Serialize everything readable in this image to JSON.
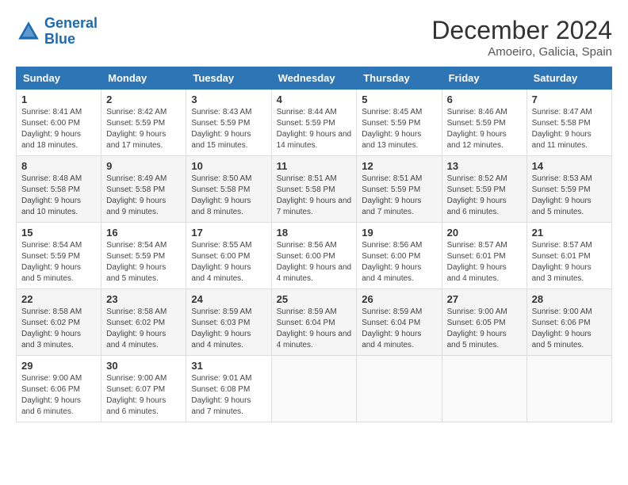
{
  "header": {
    "logo_line1": "General",
    "logo_line2": "Blue",
    "month": "December 2024",
    "location": "Amoeiro, Galicia, Spain"
  },
  "days_of_week": [
    "Sunday",
    "Monday",
    "Tuesday",
    "Wednesday",
    "Thursday",
    "Friday",
    "Saturday"
  ],
  "weeks": [
    [
      {
        "day": "1",
        "info": "Sunrise: 8:41 AM\nSunset: 6:00 PM\nDaylight: 9 hours and 18 minutes."
      },
      {
        "day": "2",
        "info": "Sunrise: 8:42 AM\nSunset: 5:59 PM\nDaylight: 9 hours and 17 minutes."
      },
      {
        "day": "3",
        "info": "Sunrise: 8:43 AM\nSunset: 5:59 PM\nDaylight: 9 hours and 15 minutes."
      },
      {
        "day": "4",
        "info": "Sunrise: 8:44 AM\nSunset: 5:59 PM\nDaylight: 9 hours and 14 minutes."
      },
      {
        "day": "5",
        "info": "Sunrise: 8:45 AM\nSunset: 5:59 PM\nDaylight: 9 hours and 13 minutes."
      },
      {
        "day": "6",
        "info": "Sunrise: 8:46 AM\nSunset: 5:59 PM\nDaylight: 9 hours and 12 minutes."
      },
      {
        "day": "7",
        "info": "Sunrise: 8:47 AM\nSunset: 5:58 PM\nDaylight: 9 hours and 11 minutes."
      }
    ],
    [
      {
        "day": "8",
        "info": "Sunrise: 8:48 AM\nSunset: 5:58 PM\nDaylight: 9 hours and 10 minutes."
      },
      {
        "day": "9",
        "info": "Sunrise: 8:49 AM\nSunset: 5:58 PM\nDaylight: 9 hours and 9 minutes."
      },
      {
        "day": "10",
        "info": "Sunrise: 8:50 AM\nSunset: 5:58 PM\nDaylight: 9 hours and 8 minutes."
      },
      {
        "day": "11",
        "info": "Sunrise: 8:51 AM\nSunset: 5:58 PM\nDaylight: 9 hours and 7 minutes."
      },
      {
        "day": "12",
        "info": "Sunrise: 8:51 AM\nSunset: 5:59 PM\nDaylight: 9 hours and 7 minutes."
      },
      {
        "day": "13",
        "info": "Sunrise: 8:52 AM\nSunset: 5:59 PM\nDaylight: 9 hours and 6 minutes."
      },
      {
        "day": "14",
        "info": "Sunrise: 8:53 AM\nSunset: 5:59 PM\nDaylight: 9 hours and 5 minutes."
      }
    ],
    [
      {
        "day": "15",
        "info": "Sunrise: 8:54 AM\nSunset: 5:59 PM\nDaylight: 9 hours and 5 minutes."
      },
      {
        "day": "16",
        "info": "Sunrise: 8:54 AM\nSunset: 5:59 PM\nDaylight: 9 hours and 5 minutes."
      },
      {
        "day": "17",
        "info": "Sunrise: 8:55 AM\nSunset: 6:00 PM\nDaylight: 9 hours and 4 minutes."
      },
      {
        "day": "18",
        "info": "Sunrise: 8:56 AM\nSunset: 6:00 PM\nDaylight: 9 hours and 4 minutes."
      },
      {
        "day": "19",
        "info": "Sunrise: 8:56 AM\nSunset: 6:00 PM\nDaylight: 9 hours and 4 minutes."
      },
      {
        "day": "20",
        "info": "Sunrise: 8:57 AM\nSunset: 6:01 PM\nDaylight: 9 hours and 4 minutes."
      },
      {
        "day": "21",
        "info": "Sunrise: 8:57 AM\nSunset: 6:01 PM\nDaylight: 9 hours and 3 minutes."
      }
    ],
    [
      {
        "day": "22",
        "info": "Sunrise: 8:58 AM\nSunset: 6:02 PM\nDaylight: 9 hours and 3 minutes."
      },
      {
        "day": "23",
        "info": "Sunrise: 8:58 AM\nSunset: 6:02 PM\nDaylight: 9 hours and 4 minutes."
      },
      {
        "day": "24",
        "info": "Sunrise: 8:59 AM\nSunset: 6:03 PM\nDaylight: 9 hours and 4 minutes."
      },
      {
        "day": "25",
        "info": "Sunrise: 8:59 AM\nSunset: 6:04 PM\nDaylight: 9 hours and 4 minutes."
      },
      {
        "day": "26",
        "info": "Sunrise: 8:59 AM\nSunset: 6:04 PM\nDaylight: 9 hours and 4 minutes."
      },
      {
        "day": "27",
        "info": "Sunrise: 9:00 AM\nSunset: 6:05 PM\nDaylight: 9 hours and 5 minutes."
      },
      {
        "day": "28",
        "info": "Sunrise: 9:00 AM\nSunset: 6:06 PM\nDaylight: 9 hours and 5 minutes."
      }
    ],
    [
      {
        "day": "29",
        "info": "Sunrise: 9:00 AM\nSunset: 6:06 PM\nDaylight: 9 hours and 6 minutes."
      },
      {
        "day": "30",
        "info": "Sunrise: 9:00 AM\nSunset: 6:07 PM\nDaylight: 9 hours and 6 minutes."
      },
      {
        "day": "31",
        "info": "Sunrise: 9:01 AM\nSunset: 6:08 PM\nDaylight: 9 hours and 7 minutes."
      },
      {
        "day": "",
        "info": ""
      },
      {
        "day": "",
        "info": ""
      },
      {
        "day": "",
        "info": ""
      },
      {
        "day": "",
        "info": ""
      }
    ]
  ]
}
